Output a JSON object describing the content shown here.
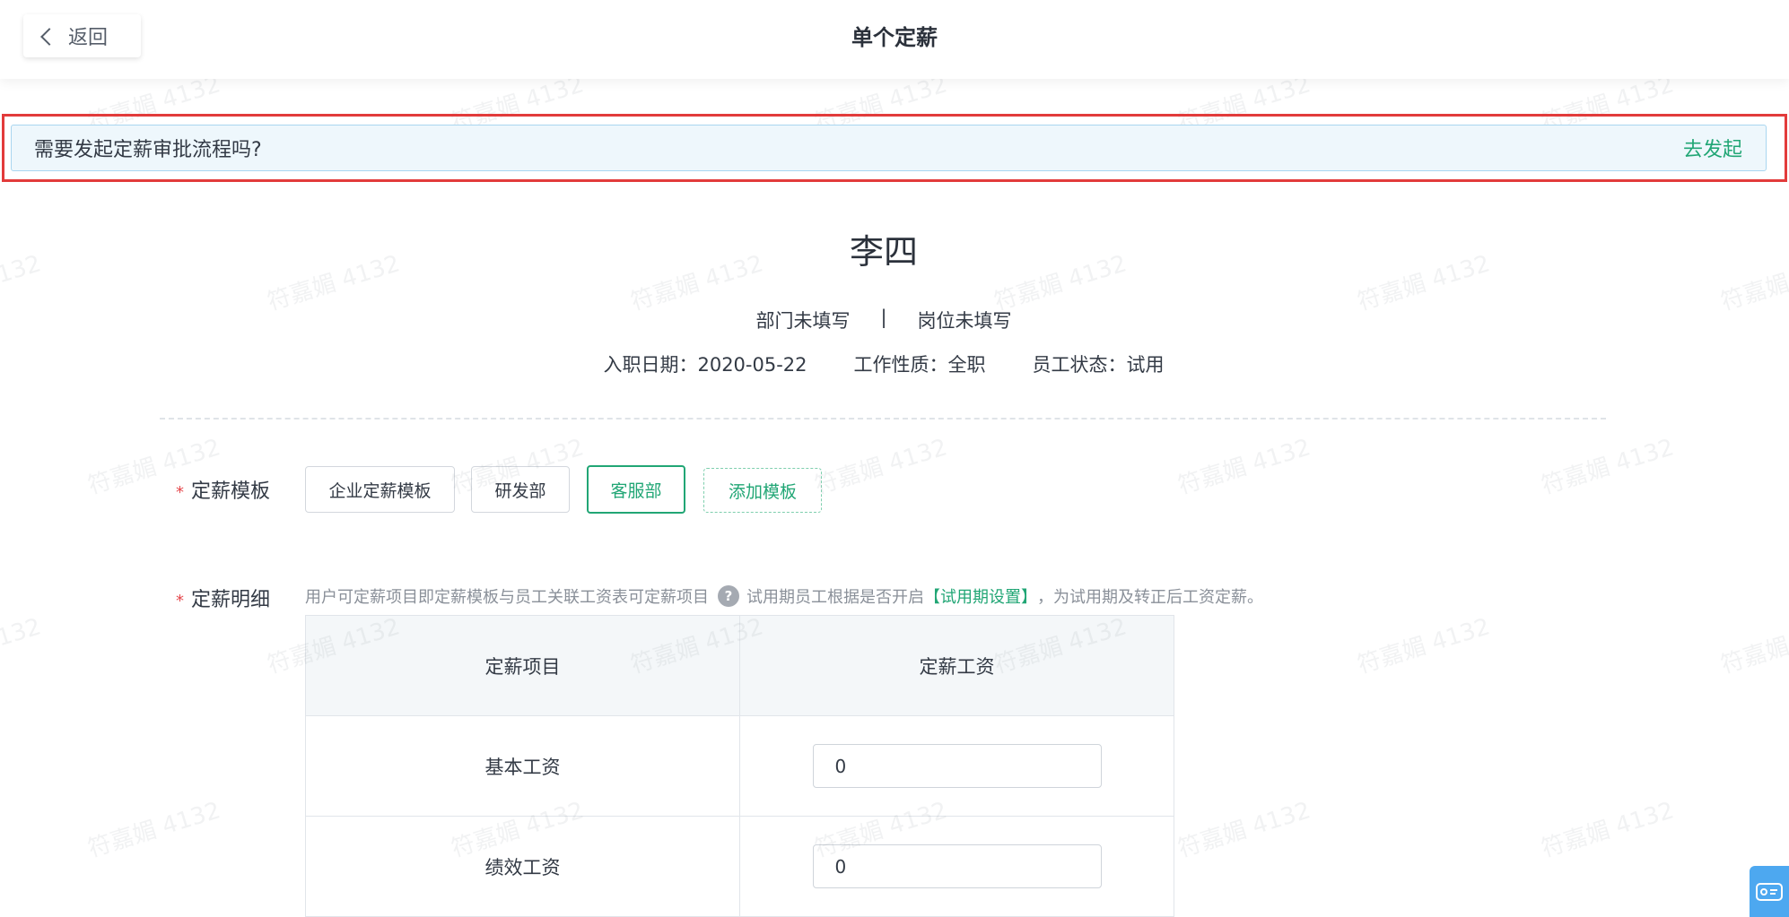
{
  "header": {
    "back_label": "返回",
    "title": "单个定薪"
  },
  "notice": {
    "text": "需要发起定薪审批流程吗?",
    "action_label": "去发起"
  },
  "employee": {
    "name": "李四",
    "department": "部门未填写",
    "separator": "|",
    "position": "岗位未填写",
    "hire_date": "入职日期：2020-05-22",
    "work_type": "工作性质：全职",
    "status": "员工状态：试用"
  },
  "form": {
    "template_label": "定薪模板",
    "templates": [
      "企业定薪模板",
      "研发部",
      "客服部"
    ],
    "selected_template": "客服部",
    "add_template_label": "添加模板",
    "detail_label": "定薪明细",
    "hint_prefix": "用户可定薪项目即定薪模板与员工关联工资表可定薪项目",
    "hint_middle": "试用期员工根据是否开启",
    "hint_link": "【试用期设置】",
    "hint_suffix": "，为试用期及转正后工资定薪。"
  },
  "table": {
    "headers": [
      "定薪项目",
      "定薪工资"
    ],
    "rows": [
      {
        "item": "基本工资",
        "value": "0"
      },
      {
        "item": "绩效工资",
        "value": "0"
      }
    ]
  },
  "watermark": "符嘉媚 4132",
  "colors": {
    "accent": "#21a675",
    "highlight_border": "#e23b3b",
    "notice_bg": "#eef7fc"
  }
}
